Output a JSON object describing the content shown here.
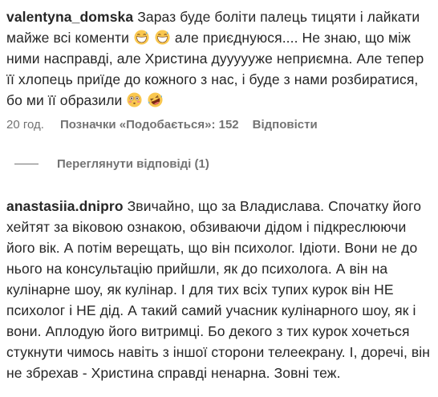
{
  "comment1": {
    "username": "valentyna_domska",
    "text_part1": "Зараз буде боліти палець тицяти і лайкати майже всі коменти",
    "text_part2": "але приєднуюся.... Не знаю, що між ними насправді, але Христина дуууууже неприємна. Але тепер її хлопець приїде до кожного з нас, і буде з нами розбиратися, бо ми її образили",
    "emojis": [
      "grinning-sweat-emoji",
      "grinning-sweat-emoji",
      "flushed-face-emoji",
      "rolling-laughing-emoji"
    ],
    "time": "20 год.",
    "likes": "Позначки «Подобається»: 152",
    "reply_label": "Відповісти"
  },
  "view_replies": {
    "label": "Переглянути відповіді (1)"
  },
  "comment2": {
    "username": "anastasiia.dnipro",
    "text": "Звичайно, що за Владислава. Спочатку його хейтят за віковою ознакою, обзиваючи дідом і підкреслюючи його вік. А потім верещать, що він психолог. Ідіоти. Вони не до нього на консультацію прийшли, як до психолога. А він на кулінарне шоу, як кулінар. І для тих всіх тупих курок він НЕ психолог і НЕ дід. А такий самий учасник кулінарного шоу, як і вони. Аплодую його витримці. Бо декого з тих курок хочеться стукнути чимось навіть з іншої сторони телеекрану. І, доречі, він не збрехав - Христина справді ненарна. Зовні теж."
  }
}
